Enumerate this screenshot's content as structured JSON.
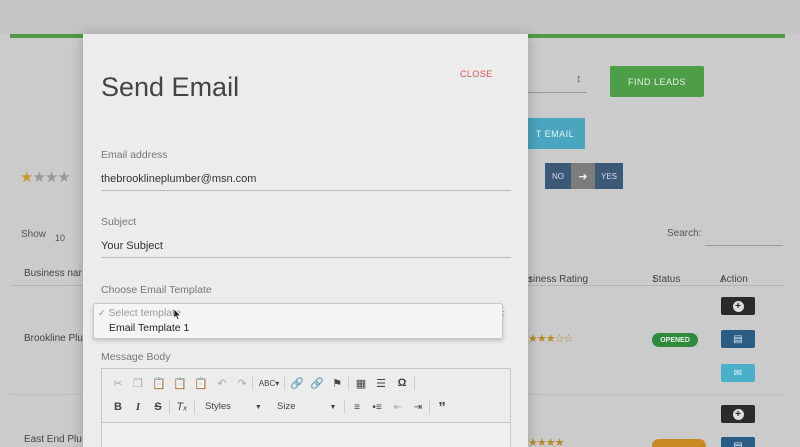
{
  "background": {
    "find_leads_label": "FIND LEADS",
    "email_button_label": "T EMAIL",
    "toggle": {
      "no": "NO",
      "yes": "YES"
    },
    "show_label": "Show",
    "show_value": "10",
    "search_label": "Search:",
    "table": {
      "headers": {
        "business_name": "Business nar",
        "business_rating": "siness Rating",
        "status": "Status",
        "action": "Action"
      },
      "rows": [
        {
          "name": "Brookline Plu",
          "status": "OPENED"
        },
        {
          "name": "East End Plu"
        }
      ]
    }
  },
  "modal": {
    "title": "Send Email",
    "close_label": "CLOSE",
    "email_label": "Email address",
    "email_value": "thebrooklineplumber@msn.com",
    "subject_label": "Subject",
    "subject_value": "Your Subject",
    "template_label": "Choose Email Template",
    "template_options": {
      "placeholder": "Select template",
      "item": "Email Template 1"
    },
    "message_label": "Message Body",
    "toolbar": {
      "styles": "Styles",
      "size": "Size"
    }
  },
  "colors": {
    "primary_green": "#4d9e47",
    "close_red": "#d9534f",
    "info_teal": "#4aa6bf",
    "navy": "#2a5d86"
  }
}
